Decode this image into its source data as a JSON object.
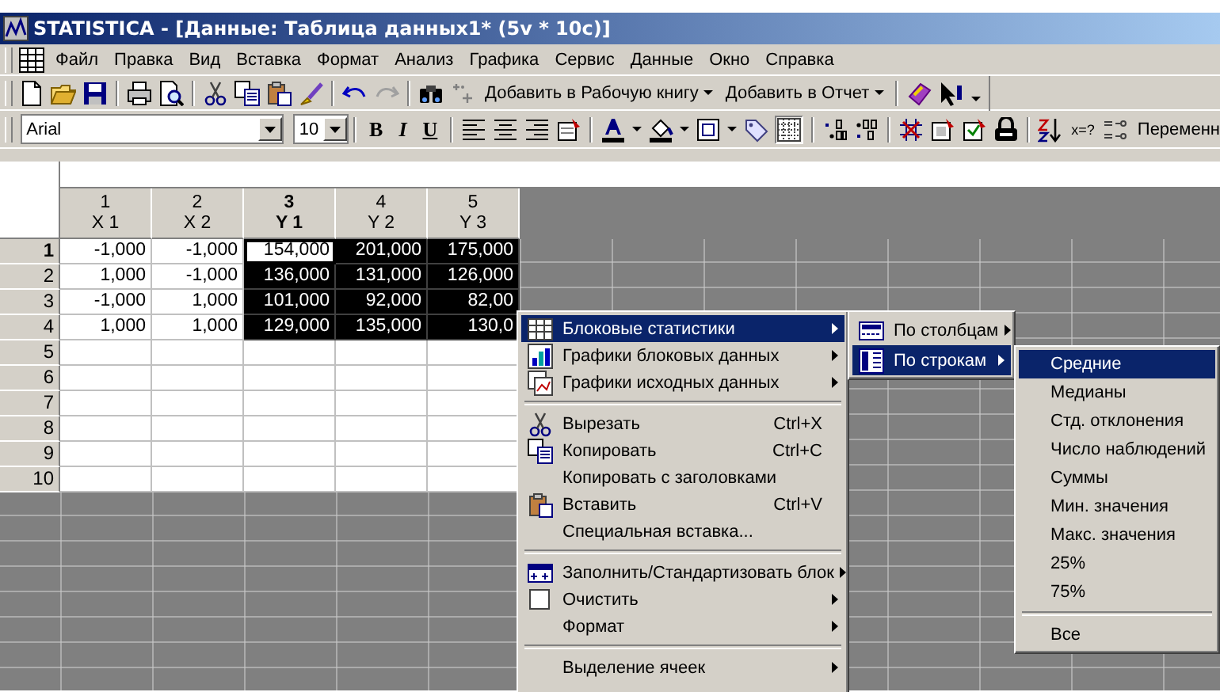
{
  "window": {
    "title": "STATISTICA - [Данные: Таблица данных1* (5v * 10c)]"
  },
  "menu_bar": [
    {
      "label": "Файл"
    },
    {
      "label": "Правка"
    },
    {
      "label": "Вид"
    },
    {
      "label": "Вставка"
    },
    {
      "label": "Формат"
    },
    {
      "label": "Анализ"
    },
    {
      "label": "Графика"
    },
    {
      "label": "Сервис"
    },
    {
      "label": "Данные"
    },
    {
      "label": "Окно"
    },
    {
      "label": "Справка"
    }
  ],
  "toolbar": {
    "text_buttons": [
      {
        "label": "Добавить в Рабочую книгу"
      },
      {
        "label": "Добавить в Отчет"
      }
    ]
  },
  "format_bar": {
    "font": "Arial",
    "size": "10",
    "style_buttons": [
      {
        "label": "B",
        "kind": "bold"
      },
      {
        "label": "I",
        "kind": "italic"
      },
      {
        "label": "U",
        "kind": "underline"
      }
    ],
    "formula_label": "x=?",
    "variables_label": "Переменн"
  },
  "sheet": {
    "columns": [
      {
        "number": "1",
        "name": "X 1",
        "active": false
      },
      {
        "number": "2",
        "name": "X 2",
        "active": false
      },
      {
        "number": "3",
        "name": "Y 1",
        "active": true
      },
      {
        "number": "4",
        "name": "Y 2",
        "active": false
      },
      {
        "number": "5",
        "name": "Y 3",
        "active": false
      }
    ],
    "rows": [
      {
        "number": "1",
        "active": true,
        "cells": [
          {
            "value": "-1,000",
            "selected": false,
            "active": false
          },
          {
            "value": "-1,000",
            "selected": false,
            "active": false
          },
          {
            "value": "154,000",
            "selected": true,
            "active": true
          },
          {
            "value": "201,000",
            "selected": true,
            "active": false
          },
          {
            "value": "175,000",
            "selected": true,
            "active": false
          }
        ]
      },
      {
        "number": "2",
        "active": false,
        "cells": [
          {
            "value": "1,000",
            "selected": false,
            "active": false
          },
          {
            "value": "-1,000",
            "selected": false,
            "active": false
          },
          {
            "value": "136,000",
            "selected": true,
            "active": false
          },
          {
            "value": "131,000",
            "selected": true,
            "active": false
          },
          {
            "value": "126,000",
            "selected": true,
            "active": false
          }
        ]
      },
      {
        "number": "3",
        "active": false,
        "cells": [
          {
            "value": "-1,000",
            "selected": false,
            "active": false
          },
          {
            "value": "1,000",
            "selected": false,
            "active": false
          },
          {
            "value": "101,000",
            "selected": true,
            "active": false
          },
          {
            "value": "92,000",
            "selected": true,
            "active": false
          },
          {
            "value": "82,00",
            "selected": true,
            "active": false
          }
        ]
      },
      {
        "number": "4",
        "active": false,
        "cells": [
          {
            "value": "1,000",
            "selected": false,
            "active": false
          },
          {
            "value": "1,000",
            "selected": false,
            "active": false
          },
          {
            "value": "129,000",
            "selected": true,
            "active": false
          },
          {
            "value": "135,000",
            "selected": true,
            "active": false
          },
          {
            "value": "130,0",
            "selected": true,
            "active": false
          }
        ]
      },
      {
        "number": "5",
        "active": false
      },
      {
        "number": "6",
        "active": false
      },
      {
        "number": "7",
        "active": false
      },
      {
        "number": "8",
        "active": false
      },
      {
        "number": "9",
        "active": false
      },
      {
        "number": "10",
        "active": false
      }
    ]
  },
  "context_menu": {
    "items": [
      {
        "kind": "item",
        "label": "Блоковые статистики",
        "has_submenu": true,
        "selected": true
      },
      {
        "kind": "item",
        "label": "Графики блоковых данных",
        "has_submenu": true,
        "selected": false
      },
      {
        "kind": "item",
        "label": "Графики исходных данных",
        "has_submenu": true,
        "selected": false
      },
      {
        "kind": "separator"
      },
      {
        "kind": "item",
        "label": "Вырезать",
        "shortcut": "Ctrl+X",
        "selected": false
      },
      {
        "kind": "item",
        "label": "Копировать",
        "shortcut": "Ctrl+C",
        "selected": false
      },
      {
        "kind": "item",
        "label": "Копировать с заголовками",
        "selected": false
      },
      {
        "kind": "item",
        "label": "Вставить",
        "shortcut": "Ctrl+V",
        "selected": false
      },
      {
        "kind": "item",
        "label": "Специальная вставка...",
        "selected": false
      },
      {
        "kind": "separator"
      },
      {
        "kind": "item",
        "label": "Заполнить/Стандартизовать блок",
        "has_submenu": true,
        "selected": false
      },
      {
        "kind": "item",
        "label": "Очистить",
        "has_submenu": true,
        "selected": false
      },
      {
        "kind": "item",
        "label": "Формат",
        "has_submenu": true,
        "selected": false
      },
      {
        "kind": "separator"
      },
      {
        "kind": "item",
        "label": "Выделение ячеек",
        "has_submenu": true,
        "selected": false
      }
    ]
  },
  "submenu": {
    "items": [
      {
        "label": "По столбцам",
        "selected": false
      },
      {
        "label": "По строкам",
        "selected": true
      }
    ]
  },
  "statistics_menu": {
    "items": [
      {
        "kind": "item",
        "label": "Средние",
        "selected": true
      },
      {
        "kind": "item",
        "label": "Медианы",
        "selected": false
      },
      {
        "kind": "item",
        "label": "Стд. отклонения",
        "selected": false
      },
      {
        "kind": "item",
        "label": "Число наблюдений",
        "selected": false
      },
      {
        "kind": "item",
        "label": "Суммы",
        "selected": false
      },
      {
        "kind": "item",
        "label": "Мин. значения",
        "selected": false
      },
      {
        "kind": "item",
        "label": "Макс. значения",
        "selected": false
      },
      {
        "kind": "item",
        "label": "25%",
        "selected": false
      },
      {
        "kind": "item",
        "label": "75%",
        "selected": false
      },
      {
        "kind": "separator"
      },
      {
        "kind": "item",
        "label": "Все",
        "selected": false
      }
    ]
  }
}
